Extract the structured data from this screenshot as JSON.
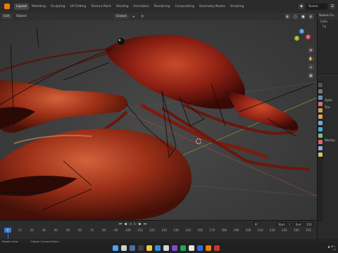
{
  "app": {
    "name": "Blender"
  },
  "workspace_tabs": [
    "Layout",
    "Modeling",
    "Sculpting",
    "UV Editing",
    "Texture Paint",
    "Shading",
    "Animation",
    "Rendering",
    "Compositing",
    "Geometry Nodes",
    "Scripting"
  ],
  "active_workspace": "Layout",
  "scene_field": "Scene",
  "header": {
    "mode": "Edit",
    "view": "Object",
    "transform_orientation": "Global"
  },
  "outliner": {
    "title": "Scene Co",
    "rows": [
      "Scene Co",
      "Colle",
      "Ca"
    ]
  },
  "properties": {
    "rows": [
      "Optio",
      "Trar",
      "Worksp"
    ]
  },
  "timeline": {
    "current_frame": "0",
    "ticks": [
      "0",
      "20",
      "40",
      "60",
      "80",
      "100",
      "120",
      "140",
      "160",
      "180",
      "200",
      "220",
      "240"
    ],
    "mid_ticks": [
      "10",
      "30",
      "50",
      "70",
      "90",
      "110",
      "130",
      "150",
      "170",
      "190",
      "210",
      "230",
      "250"
    ],
    "start_field": "Start",
    "start_value": "1",
    "end_field": "End",
    "end_value": "250",
    "frame_field": "67"
  },
  "status_bar": {
    "left": "Rotate View",
    "middle": "Object Context Menu"
  },
  "colors": {
    "accent": "#e87d0d",
    "selection": "#3b7bd1",
    "crayfish_shell": "#8c1f13",
    "viewport_bg": "#3c3c3c"
  },
  "gizmo": {
    "x": "X",
    "y": "Y",
    "z": "Z"
  }
}
